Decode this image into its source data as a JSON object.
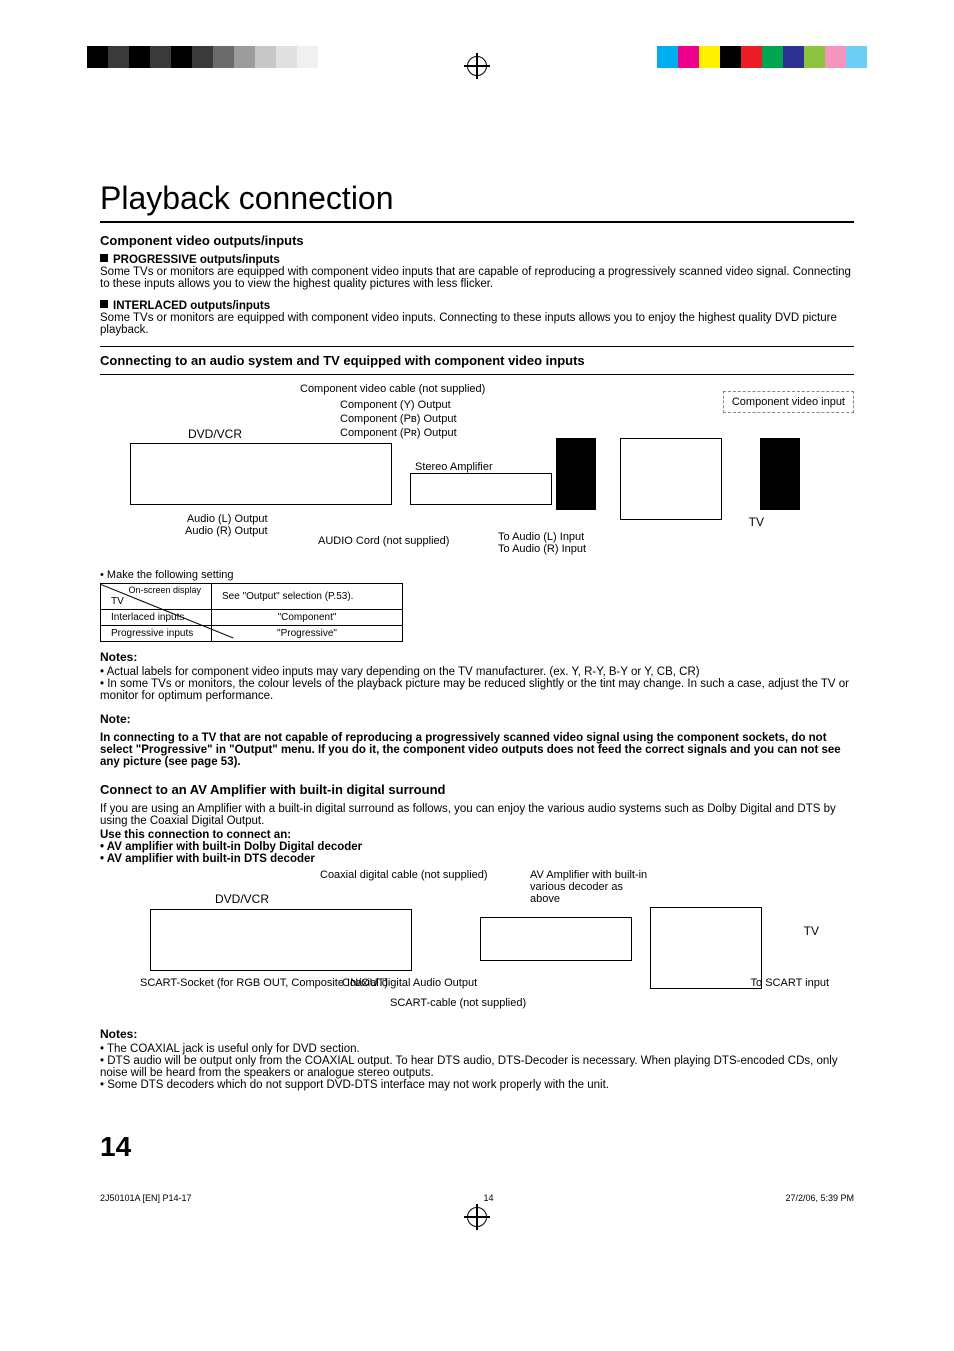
{
  "header": {
    "title": "Playback connection",
    "section1": "Component video outputs/inputs",
    "progressive_title": "PROGRESSIVE outputs/inputs",
    "progressive_body": "Some TVs or monitors are equipped with component video inputs that are capable of reproducing a progressively scanned video signal. Connecting to these inputs allows you to view the highest quality pictures with less flicker.",
    "interlaced_title": "INTERLACED outputs/inputs",
    "interlaced_body": "Some TVs or monitors are equipped with component video inputs. Connecting to these inputs allows you to enjoy the highest quality DVD picture playback.",
    "section2": "Connecting to an audio system and TV equipped with component video inputs"
  },
  "diagram1": {
    "cable": "Component video cable (not supplied)",
    "comp_video_input": "Component video input",
    "y_out": "Component (Y) Output",
    "pb_out": "Component (Pʙ) Output",
    "pr_out": "Component (Pʀ) Output",
    "dvdvcr": "DVD/VCR",
    "stereo_amp": "Stereo Amplifier",
    "tv": "TV",
    "audio_l_out": "Audio (L) Output",
    "audio_r_out": "Audio (R) Output",
    "audio_cord": "AUDIO Cord (not supplied)",
    "to_audio_l": "To Audio (L) Input",
    "to_audio_r": "To Audio (R) Input",
    "make_setting": "Make the following setting"
  },
  "settings_table": {
    "col1": "On-screen display",
    "col2": "See \"Output\" selection (P.53).",
    "row1c1": "TV",
    "row2c1": "Interlaced inputs",
    "row2c2": "\"Component\"",
    "row3c1": "Progressive inputs",
    "row3c2": "\"Progressive\""
  },
  "notes1": {
    "heading": "Notes:",
    "n1": "Actual labels for component video inputs may vary depending on the TV manufacturer. (ex. Y, R-Y, B-Y or Y, CB, CR)",
    "n2": "In some TVs or monitors, the colour levels of the playback picture may be reduced slightly or the tint may change. In such a case, adjust the TV or monitor for optimum performance."
  },
  "note_bold": {
    "heading": "Note:",
    "body": "In connecting to a TV that are not capable of reproducing a progressively scanned video signal using the component sockets, do not select \"Progressive\" in \"Output\" menu. If you do it, the component video outputs does not feed the correct signals and you can not see any picture (see page 53)."
  },
  "section3": {
    "heading": "Connect to an AV Amplifier with built-in digital surround",
    "intro": "If you are using an Amplifier with a built-in digital surround as follows, you can enjoy the various audio systems such as Dolby Digital and DTS by using the Coaxial Digital Output.",
    "use_this": "Use this connection to connect an:",
    "b1": "• AV amplifier with built-in Dolby Digital decoder",
    "b2": "• AV amplifier with built-in DTS decoder"
  },
  "diagram2": {
    "coax_cable": "Coaxial digital cable (not supplied)",
    "dvdvcr": "DVD/VCR",
    "av_amp": "AV Amplifier with built-in various decoder as above",
    "tv": "TV",
    "scart_socket": "SCART-Socket (for RGB OUT, Composite IN/OUT)",
    "coax_out": "Coaxial digital Audio Output",
    "scart_cable": "SCART-cable (not supplied)",
    "to_scart": "To SCART input"
  },
  "notes2": {
    "heading": "Notes:",
    "n1": "The COAXIAL jack is useful only for DVD section.",
    "n2": "DTS audio will be output only from the COAXIAL output. To hear DTS audio, DTS-Decoder is necessary. When playing DTS-encoded CDs, only noise will be heard from the speakers or analogue stereo outputs.",
    "n3": "Some DTS decoders which do not support DVD-DTS interface may not work properly with the unit."
  },
  "footer": {
    "page_number": "14",
    "meta_left": "2J50101A [EN] P14-17",
    "meta_mid": "14",
    "meta_right": "27/2/06, 5:39 PM"
  }
}
